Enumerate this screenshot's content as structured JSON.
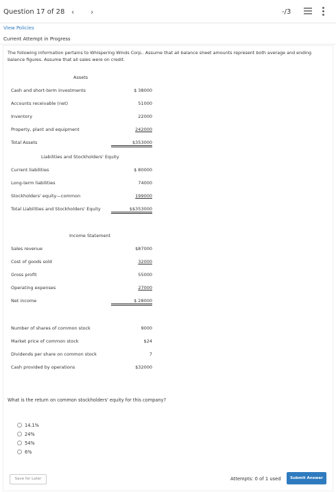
{
  "header": {
    "question_label": "Question 17 of 28",
    "prev_glyph": "‹",
    "next_glyph": "›",
    "score": "-/3",
    "list_icon": "list-icon",
    "more_icon": "more-vertical-icon"
  },
  "links": {
    "view_policies": "View Policies"
  },
  "status": {
    "attempt": "Current Attempt in Progress"
  },
  "intro": "The following information pertains to Whispering Winds Corp.. Assume that all balance sheet amounts represent both average and ending balance figures. Assume that all sales were on credit.",
  "assets": {
    "title": "Assets",
    "rows": [
      {
        "label": "Cash and short-term investments",
        "value": "$ 38000"
      },
      {
        "label": "Accounts receivable (net)",
        "value": "51000"
      },
      {
        "label": "Inventory",
        "value": "22000"
      },
      {
        "label": "Property, plant and equipment",
        "value": "242000"
      },
      {
        "label": "Total Assets",
        "value": "$353000"
      }
    ]
  },
  "liabilities": {
    "title": "Liabilities and Stockholders' Equity",
    "rows": [
      {
        "label": "Current liabilities",
        "value": "$ 80000"
      },
      {
        "label": "Long-term liabilities",
        "value": "74000"
      },
      {
        "label": "Stockholders' equity—common",
        "value": "199000"
      },
      {
        "label": "Total Liabilities and Stockholders' Equity",
        "value": "$$353000"
      }
    ]
  },
  "income": {
    "title": "Income Statement",
    "rows": [
      {
        "label": "Sales revenue",
        "value": "$87000"
      },
      {
        "label": "Cost of goods sold",
        "value": "32000"
      },
      {
        "label": "Gross profit",
        "value": "55000"
      },
      {
        "label": "Operating expenses",
        "value": "27000"
      },
      {
        "label": "Net income",
        "value": "$ 28000"
      }
    ]
  },
  "other": {
    "rows": [
      {
        "label": "Number of shares of common stock",
        "value": "9000"
      },
      {
        "label": "Market price of common stock",
        "value": "$24"
      },
      {
        "label": "Dividends per share on common stock",
        "value": "7"
      },
      {
        "label": "Cash provided by operations",
        "value": "$32000"
      }
    ]
  },
  "question": "What is the return on common stockholders' equity for this company?",
  "options": [
    "14.1%",
    "24%",
    "54%",
    "6%"
  ],
  "footer": {
    "save_later": "Save for Later",
    "attempts": "Attempts: 0 of 1 used",
    "submit": "Submit Answer"
  },
  "colors": {
    "accent": "#2f7bbf"
  }
}
